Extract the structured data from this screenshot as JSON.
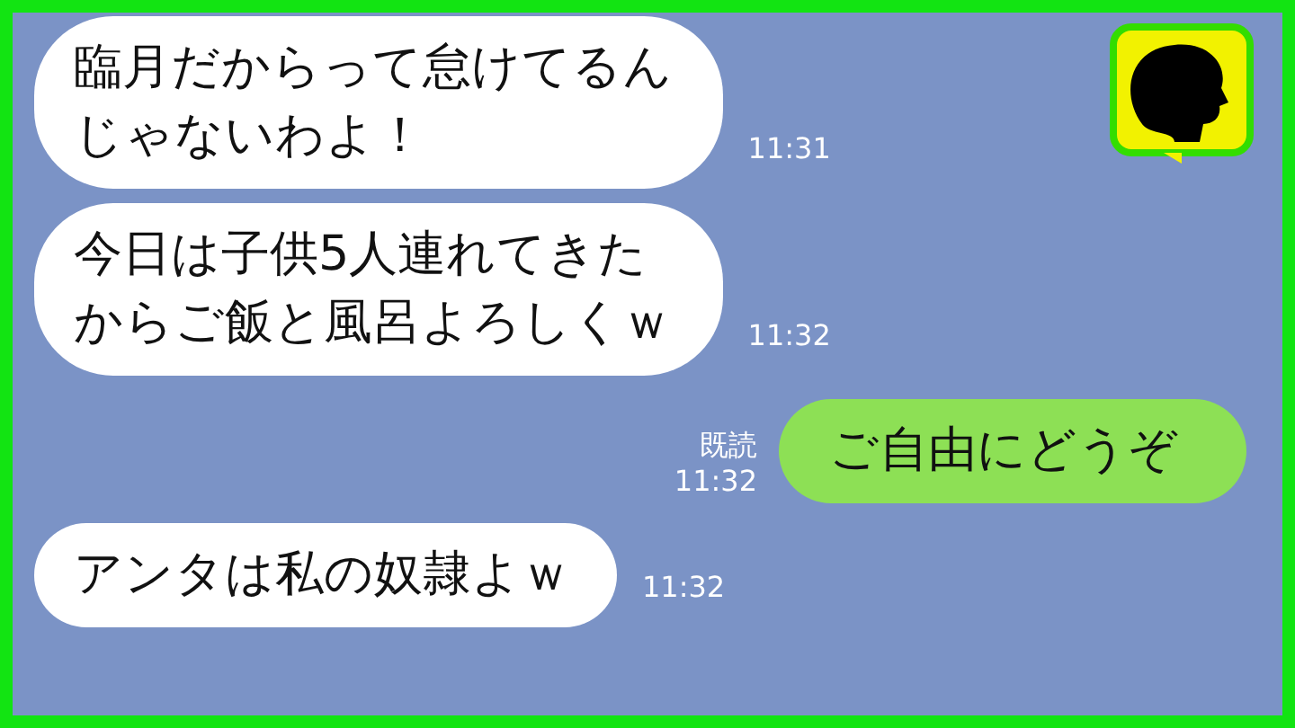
{
  "messages": [
    {
      "kind": "incoming",
      "text": "臨月だからって怠けてるんじゃないわよ！",
      "time": "11:31"
    },
    {
      "kind": "incoming",
      "text": "今日は子供5人連れてきたからご飯と風呂よろしくｗ",
      "time": "11:32"
    },
    {
      "kind": "outgoing",
      "text": "ご自由にどうぞ",
      "time": "11:32",
      "receipt": "既読"
    },
    {
      "kind": "incoming",
      "text": "アンタは私の奴隷よｗ",
      "time": "11:32"
    }
  ]
}
